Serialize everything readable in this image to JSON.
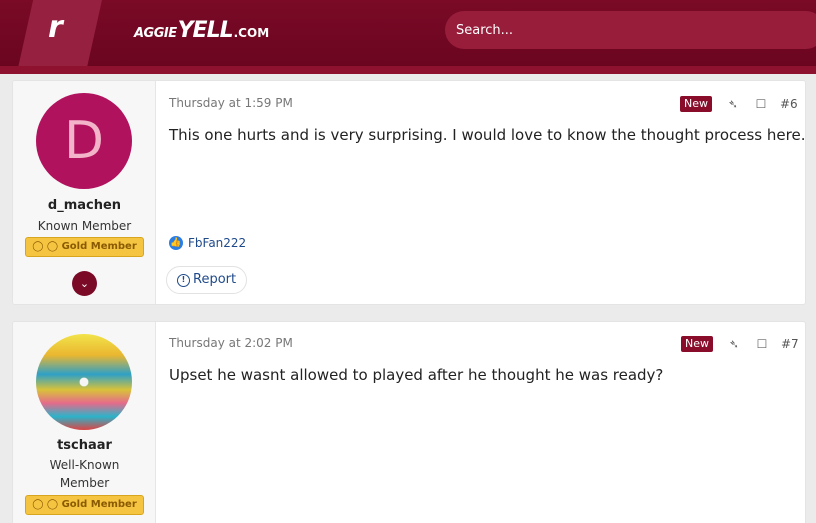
{
  "header": {
    "logo_letter": "r",
    "brand_part1": "AGGIE",
    "brand_part2": "YELL",
    "brand_part3": ".COM",
    "search_placeholder": "Search..."
  },
  "posts": [
    {
      "user": {
        "avatar_letter": "D",
        "name": "d_machen",
        "title": "Known Member",
        "badge": "Gold Member"
      },
      "date": "Thursday at 1:59 PM",
      "new_label": "New",
      "number": "#6",
      "body": "This one hurts and is very surprising. I would love to know the thought process here.",
      "reaction_user": "FbFan222",
      "report_label": "Report"
    },
    {
      "user": {
        "name": "tschaar",
        "title_line1": "Well-Known",
        "title_line2": "Member",
        "badge": "Gold Member"
      },
      "date": "Thursday at 2:02 PM",
      "new_label": "New",
      "number": "#7",
      "body": "Upset he wasnt allowed to played after he thought he was ready?"
    }
  ],
  "colors": {
    "brand": "#7a0a26",
    "badge_gold": "#f5c542",
    "link": "#1f4a8a"
  }
}
